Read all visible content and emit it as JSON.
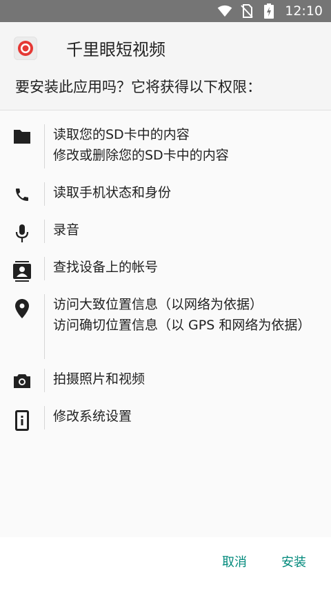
{
  "status_bar": {
    "time": "12:10"
  },
  "header": {
    "app_name": "千里眼短视频",
    "question": "要安装此应用吗？它将获得以下权限："
  },
  "permissions": [
    {
      "icon": "folder-icon",
      "lines": [
        "读取您的SD卡中的内容",
        "修改或删除您的SD卡中的内容"
      ]
    },
    {
      "icon": "phone-icon",
      "lines": [
        "读取手机状态和身份"
      ]
    },
    {
      "icon": "microphone-icon",
      "lines": [
        "录音"
      ]
    },
    {
      "icon": "contacts-icon",
      "lines": [
        "查找设备上的帐号"
      ]
    },
    {
      "icon": "location-pin-icon",
      "lines": [
        "访问大致位置信息（以网络为依据）",
        "访问确切位置信息（以 GPS 和网络为依据）"
      ]
    },
    {
      "icon": "camera-icon",
      "lines": [
        "拍摄照片和视频"
      ]
    },
    {
      "icon": "settings-phone-icon",
      "lines": [
        "修改系统设置"
      ]
    }
  ],
  "buttons": {
    "cancel": "取消",
    "install": "安装"
  },
  "colors": {
    "accent": "#00897b",
    "status_bar": "#757575",
    "app_icon_red": "#e53935"
  }
}
